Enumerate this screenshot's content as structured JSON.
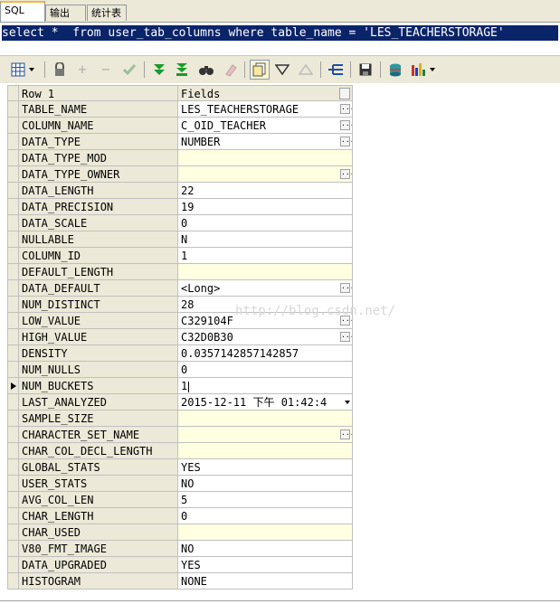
{
  "tabs": [
    {
      "label": "SQL",
      "active": true
    },
    {
      "label": "输出",
      "active": false
    },
    {
      "label": "统计表",
      "active": false
    }
  ],
  "editor": {
    "sql": "select *  from user_tab_columns where table_name = 'LES_TEACHERSTORAGE'"
  },
  "toolbar": {
    "icons": [
      "grid-view-icon",
      "lock-icon",
      "plus-icon",
      "minus-icon",
      "check-icon",
      "fetch-next-icon",
      "fetch-all-icon",
      "find-icon",
      "clear-icon",
      "single-record-icon",
      "filter-icon",
      "sort-icon",
      "query-by-example-icon",
      "save-icon",
      "export-icon",
      "chart-icon"
    ]
  },
  "grid": {
    "header": {
      "row_label": "Row 1",
      "fields_label": "Fields"
    },
    "rows": [
      {
        "name": "TABLE_NAME",
        "value": "LES_TEACHERSTORAGE",
        "ellipsis": true
      },
      {
        "name": "COLUMN_NAME",
        "value": "C_OID_TEACHER",
        "ellipsis": true
      },
      {
        "name": "DATA_TYPE",
        "value": "NUMBER",
        "ellipsis": true
      },
      {
        "name": "DATA_TYPE_MOD",
        "value": "",
        "ellipsis": false
      },
      {
        "name": "DATA_TYPE_OWNER",
        "value": "",
        "ellipsis": true
      },
      {
        "name": "DATA_LENGTH",
        "value": "22",
        "ellipsis": false
      },
      {
        "name": "DATA_PRECISION",
        "value": "19",
        "ellipsis": false
      },
      {
        "name": "DATA_SCALE",
        "value": "0",
        "ellipsis": false
      },
      {
        "name": "NULLABLE",
        "value": "N",
        "ellipsis": false
      },
      {
        "name": "COLUMN_ID",
        "value": "1",
        "ellipsis": false
      },
      {
        "name": "DEFAULT_LENGTH",
        "value": "",
        "ellipsis": false
      },
      {
        "name": "DATA_DEFAULT",
        "value": "<Long>",
        "ellipsis": true
      },
      {
        "name": "NUM_DISTINCT",
        "value": "28",
        "ellipsis": false
      },
      {
        "name": "LOW_VALUE",
        "value": "C329104F",
        "ellipsis": true
      },
      {
        "name": "HIGH_VALUE",
        "value": "C32D0B30",
        "ellipsis": true
      },
      {
        "name": "DENSITY",
        "value": "0.0357142857142857",
        "ellipsis": false
      },
      {
        "name": "NUM_NULLS",
        "value": "0",
        "ellipsis": false
      },
      {
        "name": "NUM_BUCKETS",
        "value": "1",
        "ellipsis": false,
        "current": true
      },
      {
        "name": "LAST_ANALYZED",
        "value": "2015-12-11 下午 01:42:4",
        "ellipsis": false,
        "dropdown": true
      },
      {
        "name": "SAMPLE_SIZE",
        "value": "",
        "ellipsis": false
      },
      {
        "name": "CHARACTER_SET_NAME",
        "value": "",
        "ellipsis": true
      },
      {
        "name": "CHAR_COL_DECL_LENGTH",
        "value": "",
        "ellipsis": false
      },
      {
        "name": "GLOBAL_STATS",
        "value": "YES",
        "ellipsis": false
      },
      {
        "name": "USER_STATS",
        "value": "NO",
        "ellipsis": false
      },
      {
        "name": "AVG_COL_LEN",
        "value": "5",
        "ellipsis": false
      },
      {
        "name": "CHAR_LENGTH",
        "value": "0",
        "ellipsis": false
      },
      {
        "name": "CHAR_USED",
        "value": "",
        "ellipsis": false
      },
      {
        "name": "V80_FMT_IMAGE",
        "value": "NO",
        "ellipsis": false
      },
      {
        "name": "DATA_UPGRADED",
        "value": "YES",
        "ellipsis": false
      },
      {
        "name": "HISTOGRAM",
        "value": "NONE",
        "ellipsis": false
      }
    ]
  },
  "watermark": "http://blog.csdn.net/"
}
